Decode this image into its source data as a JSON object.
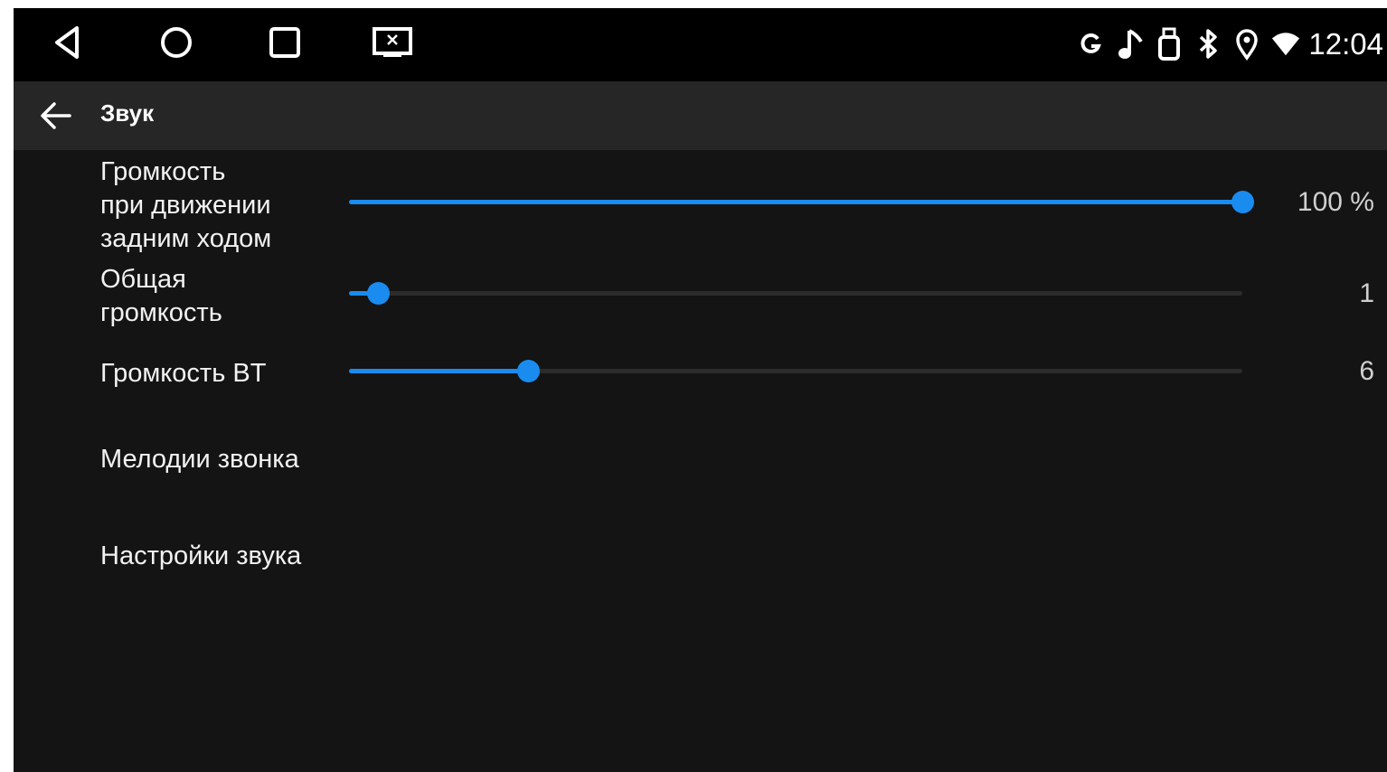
{
  "status_bar": {
    "nav": {
      "back_icon": "triangle-back-icon",
      "home_icon": "circle-home-icon",
      "recents_icon": "square-recents-icon",
      "screen_icon": "screen-mirror-icon"
    },
    "icons": [
      "google-g-icon",
      "music-note-icon",
      "usb-icon",
      "bluetooth-icon",
      "location-pin-icon",
      "wifi-icon"
    ],
    "time": "12:04"
  },
  "app_bar": {
    "back_icon": "arrow-left-icon",
    "title": "Звук"
  },
  "sliders": [
    {
      "label": "Громкость\nпри движении\nзадним ходом",
      "value_text": "100 %",
      "level": 1.0
    },
    {
      "label": "Общая\nгромкость",
      "value_text": "1",
      "level": 0.032
    },
    {
      "label": "Громкость BT",
      "value_text": "6",
      "level": 0.2
    }
  ],
  "menu": [
    {
      "label": "Мелодии звонка"
    },
    {
      "label": "Настройки звука"
    }
  ],
  "colors": {
    "accent": "#1a8cf0",
    "background": "#141414",
    "app_bar": "#262626",
    "status_bar": "#000000"
  }
}
